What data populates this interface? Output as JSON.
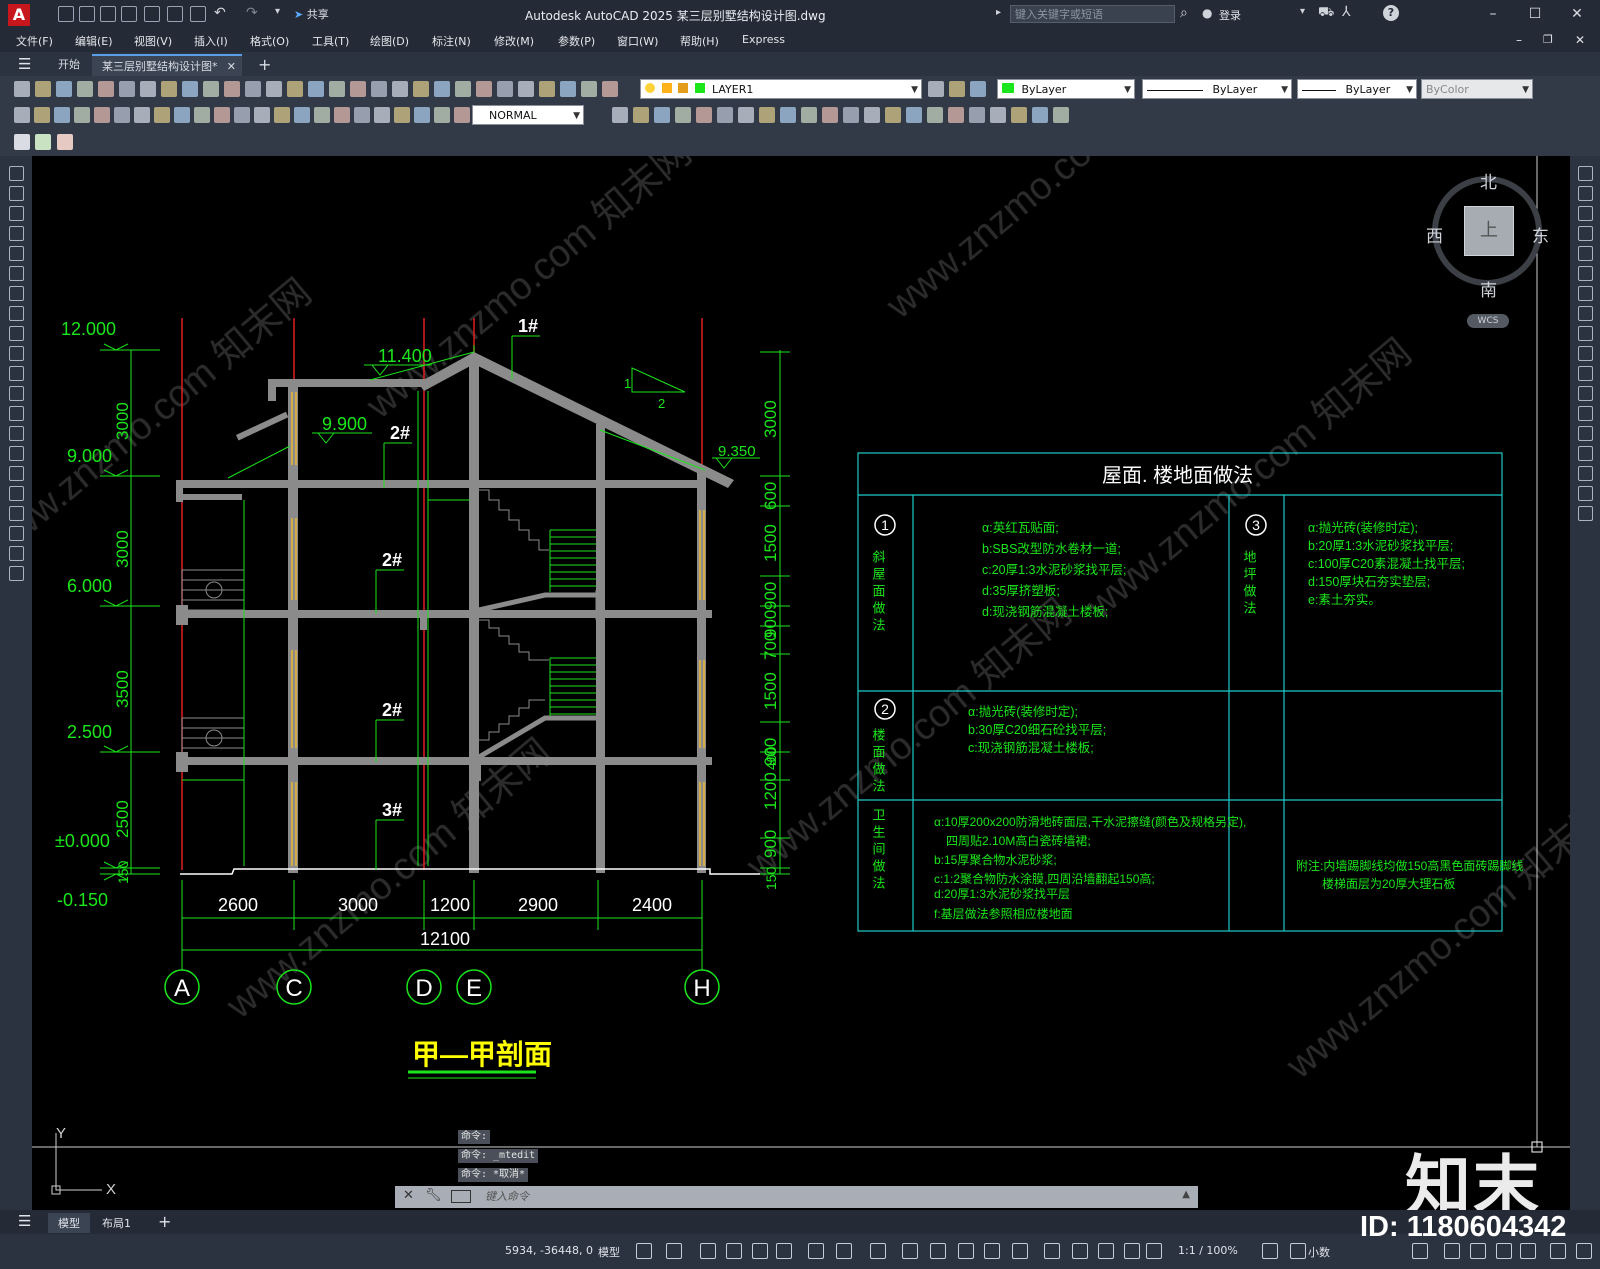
{
  "app": {
    "logo": "A",
    "title": "Autodesk AutoCAD 2025    某三层别墅结构设计图.dwg",
    "share": "共享",
    "search_placeholder": "键入关键字或短语",
    "login": "登录"
  },
  "menus": [
    "文件(F)",
    "编辑(E)",
    "视图(V)",
    "插入(I)",
    "格式(O)",
    "工具(T)",
    "绘图(D)",
    "标注(N)",
    "修改(M)",
    "参数(P)",
    "窗口(W)",
    "帮助(H)",
    "Express"
  ],
  "tabs": {
    "start": "开始",
    "document": "某三层别墅结构设计图*",
    "add": "+"
  },
  "toolbar": {
    "layer": "LAYER1",
    "color": "ByLayer",
    "linetype": "ByLayer",
    "lineweight": "ByLayer",
    "plotstyle": "ByColor",
    "textstyle": "NORMAL"
  },
  "viewcube": {
    "north": "北",
    "south": "南",
    "east": "东",
    "west": "西",
    "top": "上",
    "wcs": "WCS"
  },
  "drawing": {
    "elevations": [
      "12.000",
      "9.000",
      "6.000",
      "2.500",
      "±0.000",
      "-0.150"
    ],
    "left_dims": [
      "3000",
      "3000",
      "3500",
      "2500",
      "150"
    ],
    "right_dims": [
      "3000",
      "600",
      "1500",
      "900",
      "900",
      "700",
      "1500",
      "900",
      "1200",
      "400",
      "900",
      "150"
    ],
    "roof_levels": [
      "11.400",
      "9.900",
      "9.350"
    ],
    "tags": [
      "1#",
      "2#",
      "2#",
      "2#",
      "3#"
    ],
    "slope": [
      "1",
      "2"
    ],
    "bottom_dims": [
      "2600",
      "3000",
      "1200",
      "2900",
      "2400"
    ],
    "total_dim": "12100",
    "axes": [
      "A",
      "C",
      "D",
      "E",
      "H"
    ],
    "section_title": "甲—甲剖面"
  },
  "spec_table": {
    "title": "屋面. 楼地面做法",
    "sections": [
      {
        "num": "1",
        "name": "斜屋面做法",
        "lines": [
          "α:英红瓦贴面;",
          "b:SBS改型防水卷材一道;",
          "c:20厚1:3水泥砂浆找平层;",
          "d:35厚挤塑板;",
          "d:现浇钢筋混凝土楼板;"
        ]
      },
      {
        "num": "3",
        "name": "地坪做法",
        "lines": [
          "α:抛光砖(装修时定);",
          "b:20厚1:3水泥砂浆找平层;",
          "c:100厚C20素混凝土找平层;",
          "d:150厚块石夯实垫层;",
          "e:素土夯实。"
        ]
      },
      {
        "num": "2",
        "name": "楼面做法",
        "lines": [
          "α:抛光砖(装修时定);",
          "b:30厚C20细石砼找平层;",
          "c:现浇钢筋混凝土楼板;"
        ]
      },
      {
        "num": "",
        "name": "卫生间做法",
        "lines": [
          "α:10厚200x200防滑地砖面层,干水泥擦缝(颜色及规格另定),",
          "四周贴2.10M高白瓷砖墙裙;",
          "b:15厚聚合物水泥砂浆;",
          "c:1:2聚合物防水涂膜,四周沿墙翻起150高;",
          "d:20厚1:3水泥砂浆找平层",
          "f:基层做法参照相应楼地面"
        ]
      }
    ],
    "note": [
      "附注:内墙踢脚线均做150高黑色面砖踢脚线",
      "楼梯面层为20厚大理石板"
    ]
  },
  "command": {
    "history": [
      "命令:",
      "命令: _mtedit",
      "命令: *取消*"
    ],
    "placeholder": "键入命令"
  },
  "ucs": {
    "y": "Y",
    "x": "X"
  },
  "layout_tabs": [
    "模型",
    "布局1",
    "+"
  ],
  "status": {
    "coords": "5934, -36448, 0",
    "model": "模型",
    "scale": "1:1 / 100%",
    "units": "小数"
  },
  "watermark": {
    "logo": "知末",
    "id": "ID: 1180604342",
    "site": "www.znzmo.com 知末网"
  }
}
